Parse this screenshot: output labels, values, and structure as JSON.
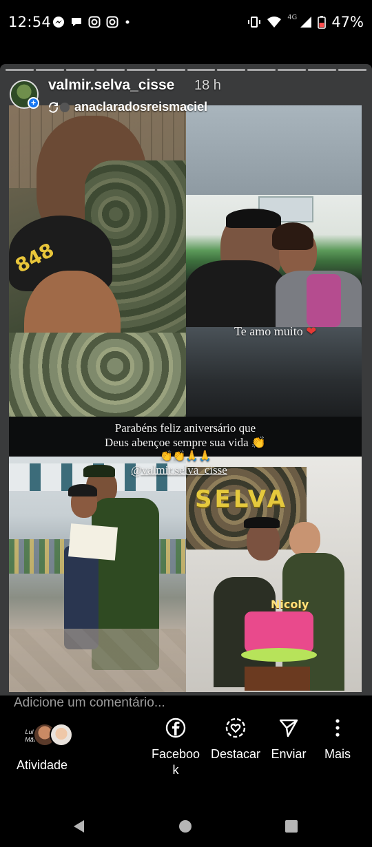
{
  "status_bar": {
    "time": "12:54",
    "network": "4G",
    "battery": "47%"
  },
  "story": {
    "username": "valmir.selva_cisse",
    "time_ago": "18 h",
    "reposted_from": "anaclaradosreismaciel",
    "texts": {
      "love": "Te amo muito",
      "birthday_line1": "Parabéns feliz aniversário que",
      "birthday_line2": "Deus abençoe sempre sua vida 👏",
      "emojis": "👏👏🙏🙏",
      "mention": "@valmir.selva_cisse",
      "banner": "SELVA",
      "cake_name": "Nicoly",
      "cap_text": "848"
    }
  },
  "comment": {
    "placeholder": "Adicione um comentário..."
  },
  "actions": {
    "activity_label": "Atividade",
    "activity_avatar_text": "Lulu Mãe",
    "facebook_label_1": "Faceboo",
    "facebook_label_2": "k",
    "highlight_label": "Destacar",
    "send_label": "Enviar",
    "more_label": "Mais"
  },
  "colors": {
    "card_bg": "#3a3b3c",
    "facebook_blue": "#1877f2",
    "selva_gold": "#e5c93d"
  },
  "icons": [
    "messenger-icon",
    "chat-icon",
    "instagram-icon",
    "wifi-icon",
    "signal-icon",
    "battery-icon",
    "facebook-icon",
    "highlight-icon",
    "send-icon",
    "more-icon",
    "back-icon",
    "home-icon",
    "recents-icon"
  ]
}
